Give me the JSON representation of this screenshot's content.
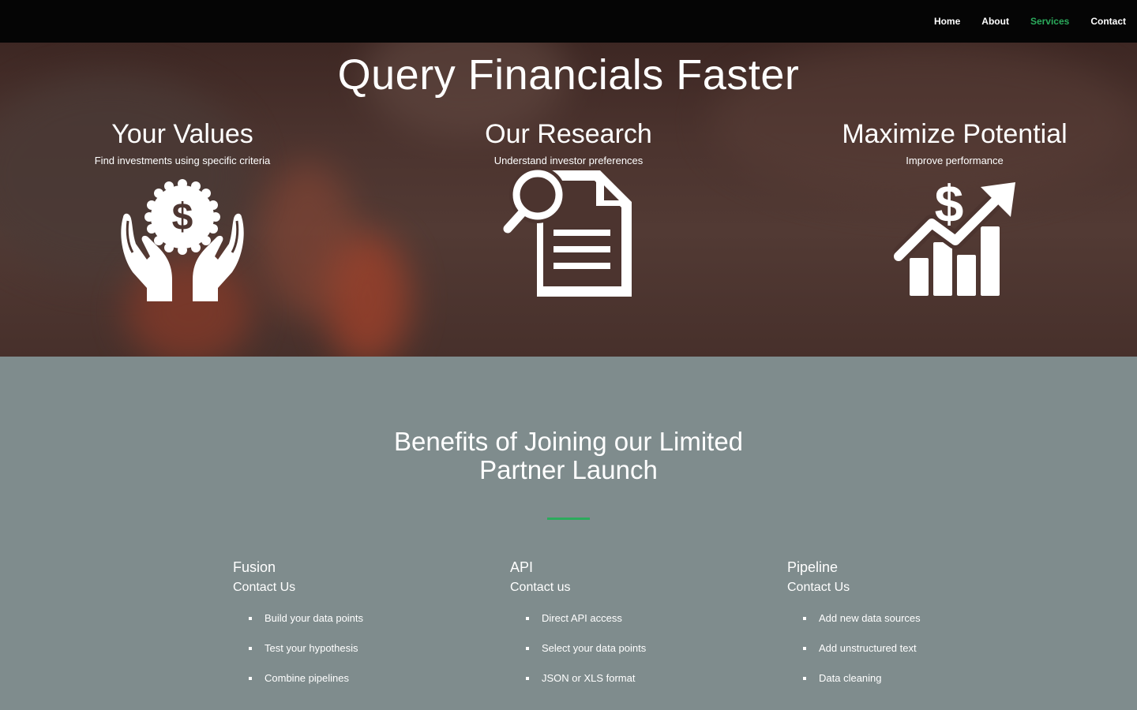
{
  "nav": {
    "items": [
      {
        "label": "Home",
        "active": false
      },
      {
        "label": "About",
        "active": false
      },
      {
        "label": "Services",
        "active": true
      },
      {
        "label": "Contact",
        "active": false
      }
    ],
    "active_color": "#2bab5c"
  },
  "hero": {
    "title": "Query Financials Faster",
    "services": [
      {
        "title": "Your Values",
        "subtitle": "Find investments using specific criteria",
        "icon": "hands-dollar-icon"
      },
      {
        "title": "Our Research",
        "subtitle": "Understand investor preferences",
        "icon": "document-search-icon"
      },
      {
        "title": "Maximize Potential",
        "subtitle": "Improve performance",
        "icon": "growth-chart-icon"
      }
    ]
  },
  "benefits": {
    "title": "Benefits of Joining our Limited Partner Launch",
    "accent_color": "#2bab5c",
    "columns": [
      {
        "title": "Fusion",
        "contact": "Contact Us",
        "items": [
          "Build your data points",
          "Test your hypothesis",
          "Combine pipelines"
        ]
      },
      {
        "title": "API",
        "contact": "Contact us",
        "items": [
          "Direct API access",
          "Select your data points",
          "JSON or XLS format"
        ]
      },
      {
        "title": "Pipeline",
        "contact": "Contact Us",
        "items": [
          "Add new data sources",
          "Add unstructured text",
          "Data cleaning"
        ]
      }
    ]
  }
}
